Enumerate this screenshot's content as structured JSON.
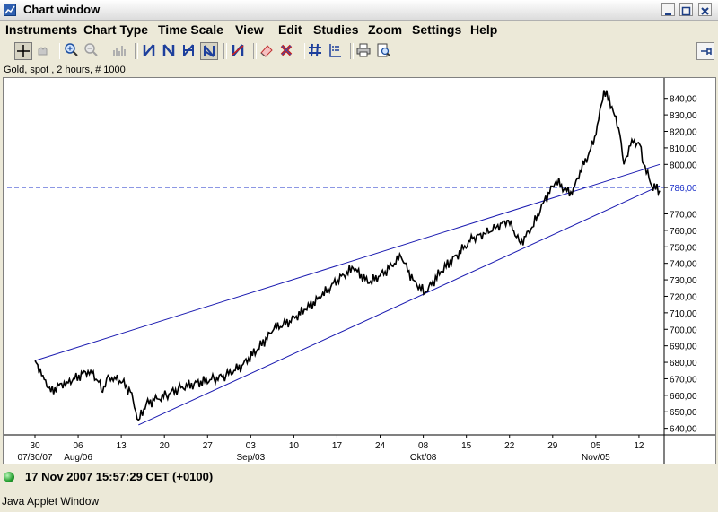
{
  "window": {
    "title": "Chart window"
  },
  "menu": [
    "Instruments",
    "Chart Type",
    "Time Scale",
    "View",
    "Edit",
    "Studies",
    "Zoom",
    "Settings",
    "Help"
  ],
  "instrument_info": "Gold, spot , 2 hours, # 1000",
  "status": {
    "timestamp": "17 Nov 2007 15:57:29 CET (+0100)"
  },
  "footer": {
    "text": "Java Applet Window"
  },
  "chart_data": {
    "type": "line",
    "title": "Gold, spot , 2 hours, # 1000",
    "ylim": [
      636,
      848
    ],
    "y_ticks": [
      "640,00",
      "650,00",
      "660,00",
      "670,00",
      "680,00",
      "690,00",
      "700,00",
      "710,00",
      "720,00",
      "730,00",
      "740,00",
      "750,00",
      "760,00",
      "770,00",
      "786,00",
      "800,00",
      "810,00",
      "820,00",
      "830,00",
      "840,00"
    ],
    "x_ticks": [
      {
        "label": "30",
        "sub": "07/30/07"
      },
      {
        "label": "06",
        "sub": "Aug/06"
      },
      {
        "label": "13",
        "sub": ""
      },
      {
        "label": "20",
        "sub": ""
      },
      {
        "label": "27",
        "sub": ""
      },
      {
        "label": "03",
        "sub": "Sep/03"
      },
      {
        "label": "10",
        "sub": ""
      },
      {
        "label": "17",
        "sub": ""
      },
      {
        "label": "24",
        "sub": ""
      },
      {
        "label": "08",
        "sub": "Okt/08"
      },
      {
        "label": "15",
        "sub": ""
      },
      {
        "label": "22",
        "sub": ""
      },
      {
        "label": "29",
        "sub": ""
      },
      {
        "label": "05",
        "sub": "Nov/05"
      },
      {
        "label": "12",
        "sub": ""
      }
    ],
    "price_points": [
      [
        0,
        681
      ],
      [
        2,
        672
      ],
      [
        4,
        662
      ],
      [
        6,
        666
      ],
      [
        8,
        668
      ],
      [
        10,
        670
      ],
      [
        12,
        673
      ],
      [
        14,
        675
      ],
      [
        16,
        668
      ],
      [
        17,
        662
      ],
      [
        18,
        670
      ],
      [
        20,
        671
      ],
      [
        22,
        668
      ],
      [
        24,
        662
      ],
      [
        26,
        645
      ],
      [
        28,
        655
      ],
      [
        30,
        657
      ],
      [
        33,
        660
      ],
      [
        36,
        664
      ],
      [
        40,
        667
      ],
      [
        45,
        670
      ],
      [
        48,
        672
      ],
      [
        52,
        678
      ],
      [
        56,
        688
      ],
      [
        60,
        700
      ],
      [
        64,
        705
      ],
      [
        68,
        712
      ],
      [
        72,
        720
      ],
      [
        76,
        730
      ],
      [
        80,
        737
      ],
      [
        84,
        728
      ],
      [
        88,
        735
      ],
      [
        92,
        744
      ],
      [
        95,
        730
      ],
      [
        98,
        722
      ],
      [
        102,
        735
      ],
      [
        106,
        745
      ],
      [
        110,
        755
      ],
      [
        113,
        758
      ],
      [
        116,
        762
      ],
      [
        119,
        766
      ],
      [
        122,
        752
      ],
      [
        125,
        762
      ],
      [
        128,
        778
      ],
      [
        131,
        790
      ],
      [
        133,
        785
      ],
      [
        135,
        782
      ],
      [
        137,
        796
      ],
      [
        139,
        805
      ],
      [
        141,
        818
      ],
      [
        143,
        845
      ],
      [
        145,
        835
      ],
      [
        147,
        818
      ],
      [
        148,
        800
      ],
      [
        150,
        815
      ],
      [
        152,
        812
      ],
      [
        153,
        800
      ],
      [
        155,
        787
      ],
      [
        157,
        784
      ]
    ],
    "series": [
      {
        "name": "",
        "values": [
          [
            0,
            681
          ],
          [
            157,
            800
          ]
        ]
      },
      {
        "name": "",
        "values": [
          [
            26,
            642
          ],
          [
            157,
            787
          ]
        ]
      }
    ],
    "reference_line": 786,
    "grid": false
  }
}
